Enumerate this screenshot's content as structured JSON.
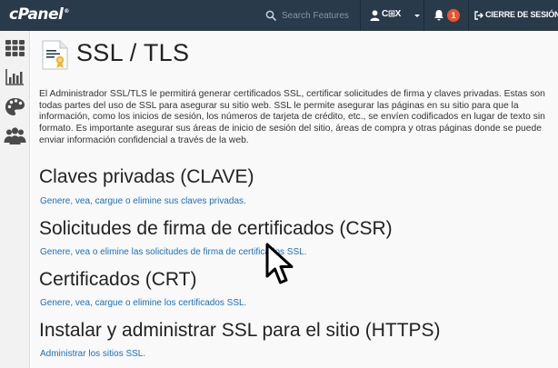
{
  "app": {
    "logo": "cPanel",
    "trademark": "®"
  },
  "header": {
    "search": {
      "placeholder": "Search Features",
      "icon": "search-icon"
    },
    "user": {
      "name": "C⊞X"
    },
    "notifications": {
      "count": "1"
    },
    "logout": {
      "label": "CIERRE DE SESIÓN"
    }
  },
  "sidebar": {
    "items": [
      {
        "name": "home",
        "icon": "grid-icon"
      },
      {
        "name": "statistics",
        "icon": "bar-chart-icon"
      },
      {
        "name": "dashboard",
        "icon": "palette-icon"
      },
      {
        "name": "users",
        "icon": "users-icon"
      }
    ]
  },
  "page": {
    "title": "SSL / TLS",
    "description": "El Administrador SSL/TLS le permitirá generar certificados SSL, certificar solicitudes de firma y claves privadas. Estas son todas partes del uso de SSL para asegurar su sitio web. SSL le permite asegurar las páginas en su sitio para que la información, como los inicios de sesión, los números de tarjeta de crédito, etc., se envíen codificados en lugar de texto sin formato. Es importante asegurar sus áreas de inicio de sesión del sitio, áreas de compra y otras páginas donde se puede enviar información confidencial a través de la web."
  },
  "sections": [
    {
      "title": "Claves privadas (CLAVE)",
      "link": "Genere, vea, cargue o elimine sus claves privadas."
    },
    {
      "title": "Solicitudes de firma de certificados (CSR)",
      "link": "Genere, vea o elimine las solicitudes de firma de certificados SSL."
    },
    {
      "title": "Certificados (CRT)",
      "link": "Genere, vea, cargue o elimine los certificados SSL."
    },
    {
      "title": "Instalar y administrar SSL para el sitio (HTTPS)",
      "link": "Administrar los sitios SSL."
    }
  ],
  "colors": {
    "topbar": "#293a4a",
    "link": "#1b6fbf",
    "badge": "#e8542c",
    "sidebar_icon": "#4a4a4a"
  }
}
